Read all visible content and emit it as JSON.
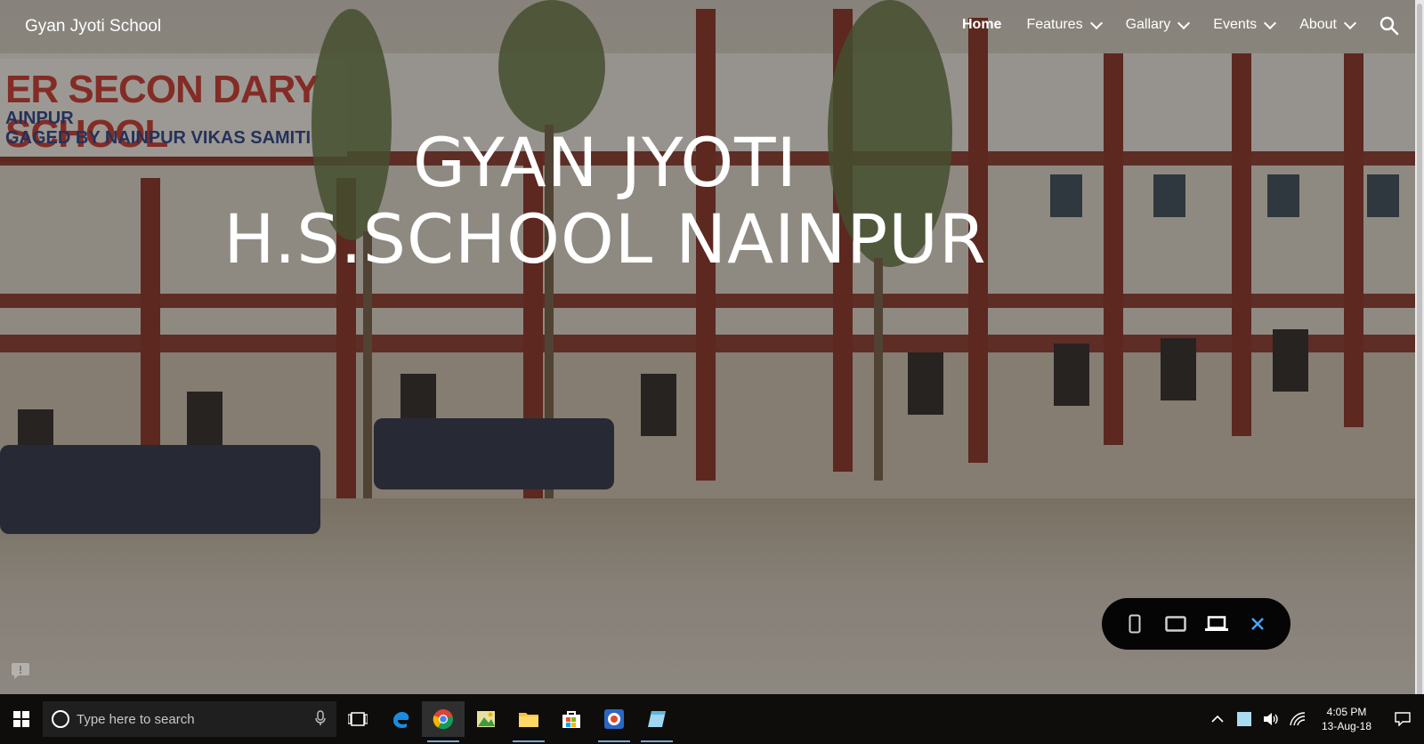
{
  "site": {
    "title": "Gyan Jyoti School"
  },
  "nav": {
    "items": [
      {
        "label": "Home",
        "active": true,
        "has_dropdown": false
      },
      {
        "label": "Features",
        "active": false,
        "has_dropdown": true
      },
      {
        "label": "Gallary",
        "active": false,
        "has_dropdown": true
      },
      {
        "label": "Events",
        "active": false,
        "has_dropdown": true
      },
      {
        "label": "About",
        "active": false,
        "has_dropdown": true
      }
    ],
    "search_icon": "search-icon"
  },
  "hero": {
    "line1": "GYAN JYOTI",
    "line2": "H.S.SCHOOL NAINPUR",
    "signboard": {
      "line1": "ER SECON DARY SCHOOL",
      "line2": "AINPUR",
      "line3": "GAGED BY NAINPUR VIKAS SAMITI"
    }
  },
  "preview_bar": {
    "buttons": [
      "phone-preview-icon",
      "tablet-preview-icon",
      "laptop-preview-icon",
      "close-icon"
    ],
    "close_color": "#4aa3ff"
  },
  "taskbar": {
    "search_placeholder": "Type here to search",
    "apps": [
      "task-view-icon",
      "edge-icon",
      "chrome-icon",
      "image-app-icon",
      "file-explorer-icon",
      "store-icon",
      "media-app-icon",
      "notes-app-icon"
    ],
    "time": "4:05 PM",
    "date": "13-Aug-18"
  }
}
